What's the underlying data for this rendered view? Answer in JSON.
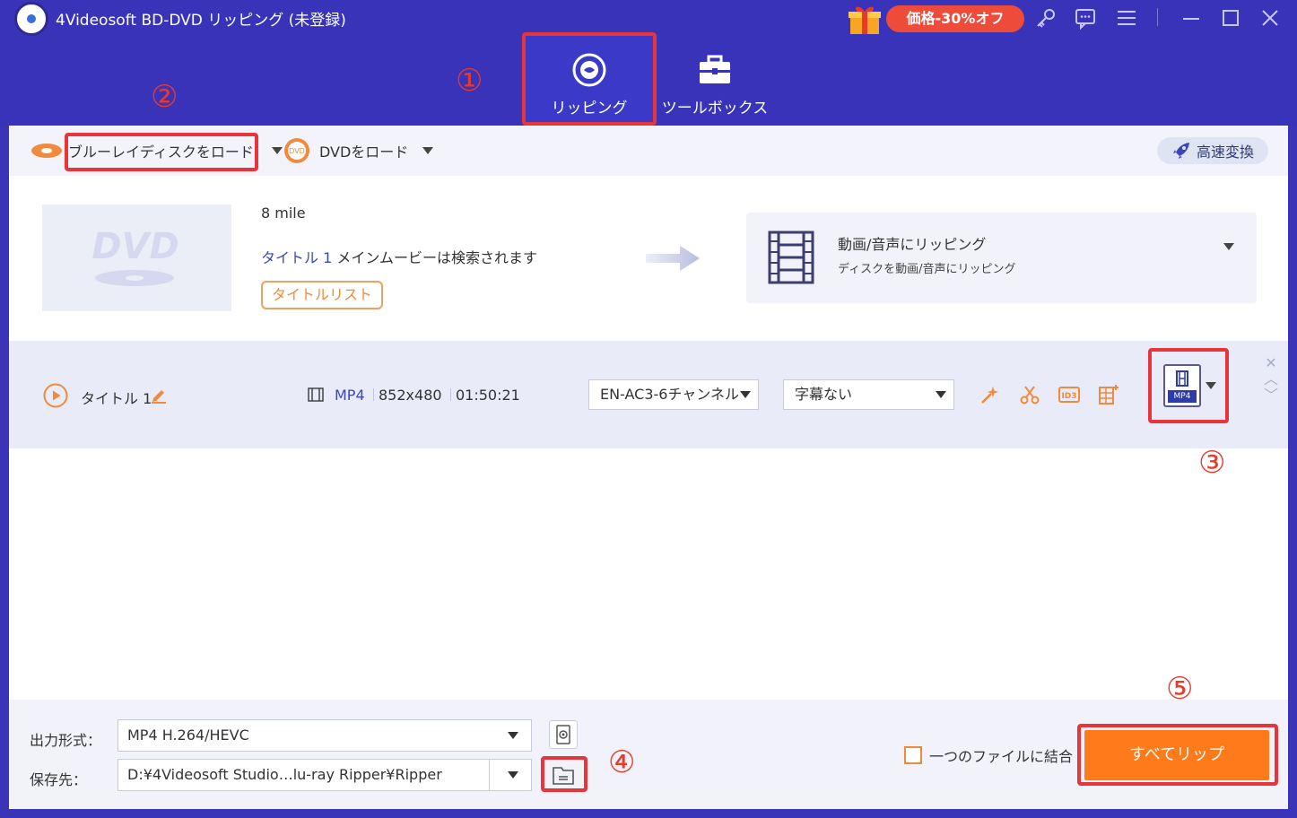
{
  "app": {
    "title": "4Videosoft BD-DVD リッピング (未登録)"
  },
  "promo": {
    "label": "価格-30%オフ"
  },
  "window_controls": {
    "key": "key-icon",
    "feedback": "chat-icon",
    "menu": "menu-icon",
    "minimize": "minimize-icon",
    "maximize": "maximize-icon",
    "close": "close-icon"
  },
  "tabs": [
    {
      "label": "リッピング",
      "icon": "disc-icon",
      "active": true
    },
    {
      "label": "ツールボックス",
      "icon": "toolbox-icon",
      "active": false
    }
  ],
  "toolbar": {
    "load_bluray": "ブルーレイディスクをロード",
    "load_dvd": "DVDをロード",
    "speed": "高速変換"
  },
  "source": {
    "disc_name": "8 mile",
    "info_title": "タイトル 1",
    "info_text": " メインムービーは検索されます",
    "title_list_button": "タイトルリスト"
  },
  "rip_mode": {
    "title": "動画/音声にリッピング",
    "subtitle": "ディスクを動画/音声にリッピング"
  },
  "title_row": {
    "name": "タイトル 1",
    "format": "MP4",
    "resolution": "852x480",
    "duration": "01:50:21",
    "audio": "EN-AC3-6チャンネル",
    "subtitle": "字幕ない",
    "output_format_tag": "MP4"
  },
  "bottom": {
    "output_format_label": "出力形式：",
    "output_format_value": "MP4 H.264/HEVC",
    "save_to_label": "保存先：",
    "save_to_value": "D:¥4Videosoft Studio…lu-ray Ripper¥Ripper",
    "merge_label": "一つのファイルに結合",
    "rip_all_button": "すべてリップ"
  },
  "callouts": [
    "①",
    "②",
    "③",
    "④",
    "⑤"
  ],
  "colors": {
    "brand": "#3833b8",
    "accent": "#ff7a1a",
    "highlight": "#e8353a"
  }
}
